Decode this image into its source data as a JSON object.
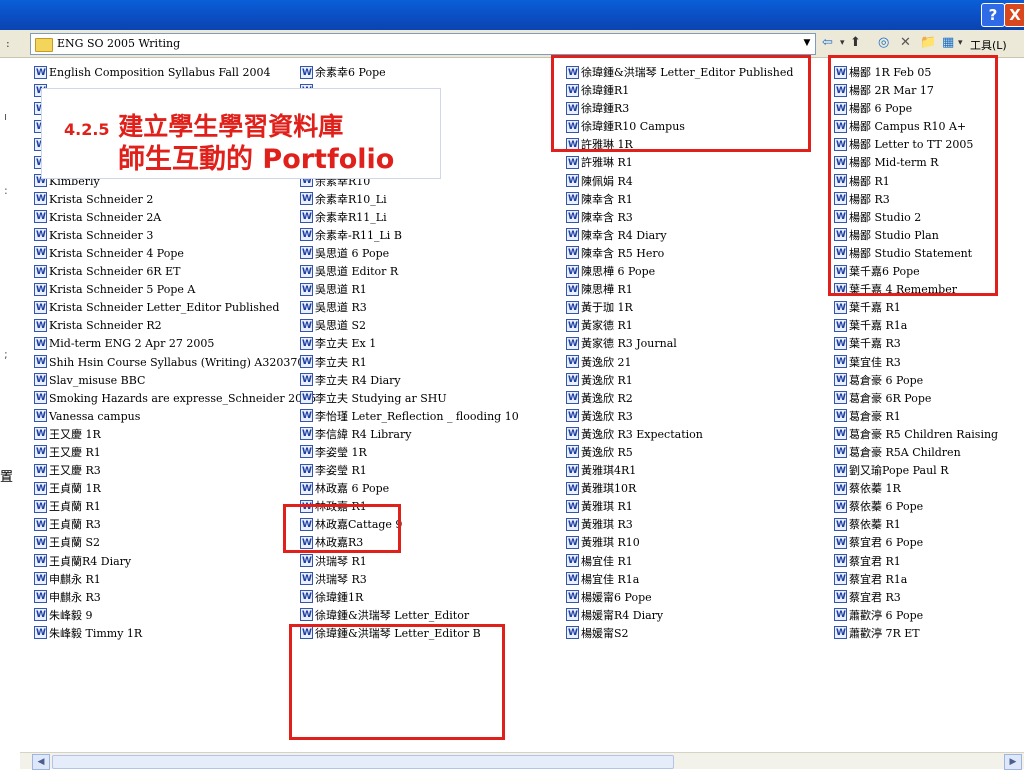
{
  "window": {
    "help_label": "?",
    "close_label": "X"
  },
  "address_bar": {
    "path": "ENG SO 2005 Writing"
  },
  "toolbar": {
    "back_icon": "⇦",
    "up_icon": "⬆",
    "search_icon": "◎",
    "delete_icon": "✕",
    "new_folder_icon": "📁",
    "views_icon": "▦",
    "tools_label": "工具(L)"
  },
  "left_strip": {
    "label": "置"
  },
  "caption": {
    "line1_num": "4.2.5",
    "line1_text": " 建立學生學習資料庫",
    "line2_text": "師生互動的 ",
    "line2_latin": "Portfolio"
  },
  "columns": [
    [
      "English Composition Syllabus Fall  2004",
      "",
      "",
      "",
      "",
      "Huang Pearl 黃雅琪R1",
      "Kimberly",
      "Krista Schneider 2",
      "Krista Schneider 2A",
      "Krista Schneider 3",
      "Krista Schneider 4 Pope",
      "Krista Schneider 6R ET",
      "Krista Schneider  5 Pope A",
      "Krista Schneider Letter_Editor Published",
      "Krista Schneider R2",
      "Mid-term ENG 2 Apr 27 2005",
      "Shih Hsin Course Syllabus (Writing) A3203702",
      "Slav_misuse BBC",
      "Smoking Hazards are expresse_Schneider 2005",
      "Vanessa campus",
      "王又慶 1R",
      "王又慶 R1",
      "王又慶 R3",
      "王貞蘭 1R",
      "王貞蘭 R1",
      "王貞蘭 R3",
      "王貞蘭 S2",
      "王貞蘭R4 Diary",
      "申麒永 R1",
      "申麒永 R3",
      "朱峰毅 9",
      "朱峰毅 Timmy 1R"
    ],
    [
      "余素幸6 Pope",
      "",
      "",
      "",
      "",
      "余素幸R7 Pope",
      "余素幸R10",
      "余素幸R10_Li",
      "余素幸R11_Li",
      "余素幸-R11_Li B",
      "吳思道 6 Pope",
      "吳思道 Editor R",
      "吳思道 R1",
      "吳思道 R3",
      "吳思道 S2",
      "李立夫 Ex 1",
      "李立夫 R1",
      "李立夫 R4 Diary",
      "李立夫 Studying ar SHU",
      "李怡瑾 Leter_Reflection _ flooding 10",
      "李信緯 R4 Library",
      "李姿瑩 1R",
      "李姿瑩 R1",
      "林政嘉 6 Pope",
      "林政嘉 R1",
      "林政嘉Cattage 9",
      "林政嘉R3",
      "洪瑞琴 R1",
      "洪瑞琴 R3",
      "徐瑋鍾1R",
      "徐瑋鍾&洪瑞琴 Letter_Editor",
      "徐瑋鍾&洪瑞琴 Letter_Editor B"
    ],
    [
      "徐瑋鍾&洪瑞琴 Letter_Editor Published",
      "徐瑋鍾R1",
      "徐瑋鍾R3",
      "徐瑋鍾R10 Campus",
      "許雅琳 1R",
      "許雅琳  R1",
      "陳佩娟 R4",
      "陳幸含 R1",
      "陳幸含 R3",
      "陳幸含 R4 Diary",
      "陳幸含 R5 Hero",
      "陳思樺 6 Pope",
      "陳思樺 R1",
      "黃于珈 1R",
      "黃家德 R1",
      "黃家德 R3 Journal",
      "黃逸欣 21",
      "黃逸欣 R1",
      "黃逸欣 R2",
      "黃逸欣 R3",
      "黃逸欣 R3 Expectation",
      "黃逸欣 R5",
      "黃雅琪4R1",
      "黃雅琪10R",
      "黃雅琪 R1",
      "黃雅琪 R3",
      "黃雅琪 R10",
      "楊宜佳 R1",
      "楊宜佳 R1a",
      "楊媛甯6 Pope",
      "楊媛甯R4 Diary",
      "楊媛甯S2"
    ],
    [
      "楊鄙 1R Feb 05",
      "楊鄙 2R Mar 17",
      "楊鄙 6 Pope",
      "楊鄙 Campus R10 A+",
      "楊鄙 Letter to TT 2005",
      "楊鄙 Mid-term R",
      "楊鄙 R1",
      "楊鄙 R3",
      "楊鄙 Studio 2",
      "楊鄙 Studio Plan",
      "楊鄙 Studio Statement",
      "葉千嘉6 Pope",
      "葉千嘉 4 Remember",
      "葉千嘉 R1",
      "葉千嘉 R1a",
      "葉千嘉 R3",
      "葉宜佳 R3",
      "葛倉豪 6 Pope",
      "葛倉豪 6R Pope",
      "葛倉豪 R1",
      "葛倉豪 R5 Children Raising",
      "葛倉豪 R5A Children",
      "劉又瑜Pope Paul R",
      "蔡依蓁 1R",
      "蔡依蓁 6 Pope",
      "蔡依蓁 R1",
      "蔡宜君 6 Pope",
      "蔡宜君 R1",
      "蔡宜君 R1a",
      "蔡宜君 R3",
      "蕭歡渟 6 Pope",
      "蕭歡渟 7R ET"
    ]
  ]
}
